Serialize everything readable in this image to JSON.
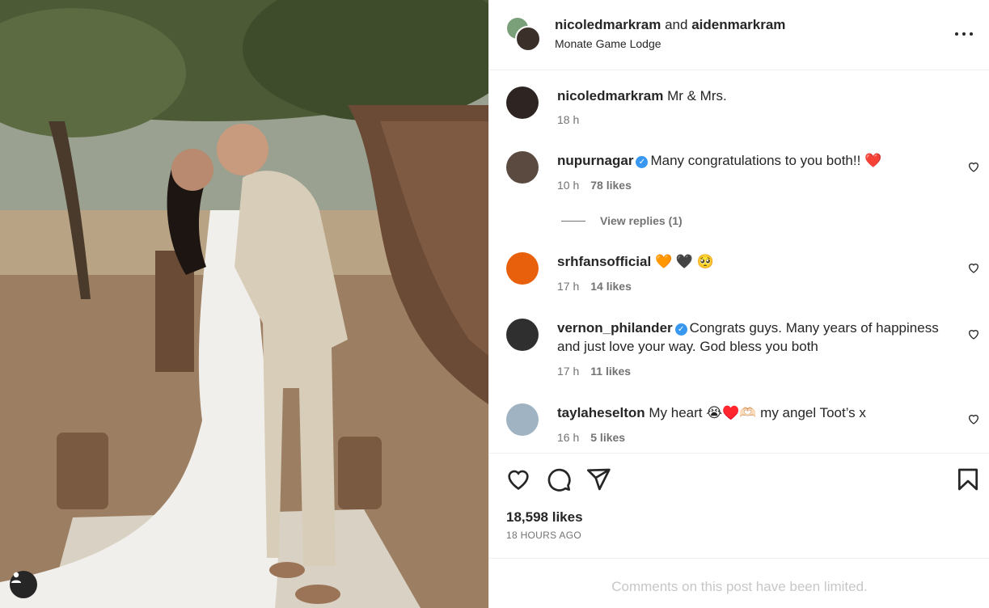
{
  "header": {
    "user1": "nicoledmarkram",
    "and_text": "and",
    "user2": "aidenmarkram",
    "location": "Monate Game Lodge"
  },
  "caption": {
    "user": "nicoledmarkram",
    "text": "Mr & Mrs.",
    "time": "18 h"
  },
  "comments": [
    {
      "user": "nupurnagar",
      "verified": true,
      "text": "Many congratulations to you both!! ❤️",
      "time": "10 h",
      "likes": "78 likes",
      "avatar_color": "#5a4a40"
    },
    {
      "user": "srhfansofficial",
      "verified": false,
      "text": "🧡 🖤 🥺",
      "time": "17 h",
      "likes": "14 likes",
      "avatar_color": "#e8600c"
    },
    {
      "user": "vernon_philander",
      "verified": true,
      "text": "Congrats guys. Many years of happiness and just love your way. God bless you both",
      "time": "17 h",
      "likes": "11 likes",
      "avatar_color": "#2f2f2f"
    },
    {
      "user": "taylaheselton",
      "verified": false,
      "text": "My heart 😭♥️🫶🏻 my angel Toot’s x",
      "time": "16 h",
      "likes": "5 likes",
      "avatar_color": "#9fb3c2"
    }
  ],
  "view_replies": "View replies (1)",
  "likes_total": "18,598 likes",
  "posted": "18 HOURS AGO",
  "limited_notice": "Comments on this post have been limited.",
  "colors": {
    "link_blue": "#3897f0",
    "muted": "#737373",
    "border": "#efefef"
  },
  "icons": [
    "more-options-icon",
    "heart-icon",
    "comment-icon",
    "share-icon",
    "bookmark-icon",
    "user-tag-icon",
    "verified-icon"
  ]
}
